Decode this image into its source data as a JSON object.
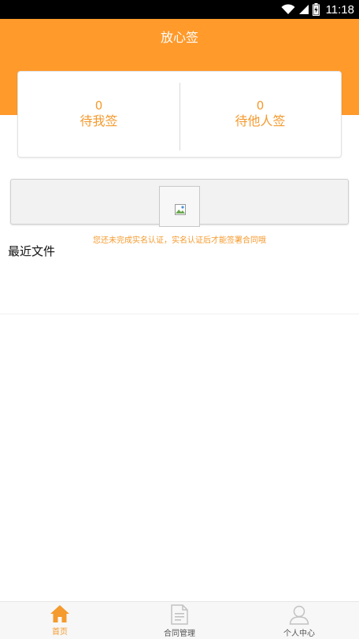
{
  "status_bar": {
    "time": "11:18",
    "icons": [
      "wifi-icon",
      "signal-icon",
      "battery-icon"
    ]
  },
  "header": {
    "title": "放心签",
    "background_color": "#FF9A2B"
  },
  "stats": {
    "to_sign_by_me": {
      "count": "0",
      "label": "待我签"
    },
    "to_sign_by_others": {
      "count": "0",
      "label": "待他人签"
    }
  },
  "banner": {
    "image_icon": "broken-image-icon"
  },
  "notice": "您还未完成实名认证，实名认证后才能签署合同哦",
  "recent": {
    "title": "最近文件"
  },
  "bottom_nav": {
    "items": [
      {
        "label": "首页",
        "icon": "home-icon",
        "active": true
      },
      {
        "label": "合同管理",
        "icon": "document-icon",
        "active": false
      },
      {
        "label": "个人中心",
        "icon": "person-icon",
        "active": false
      }
    ]
  },
  "colors": {
    "accent": "#F49A2E",
    "header": "#FF9A2B",
    "status_bar": "#000000"
  }
}
